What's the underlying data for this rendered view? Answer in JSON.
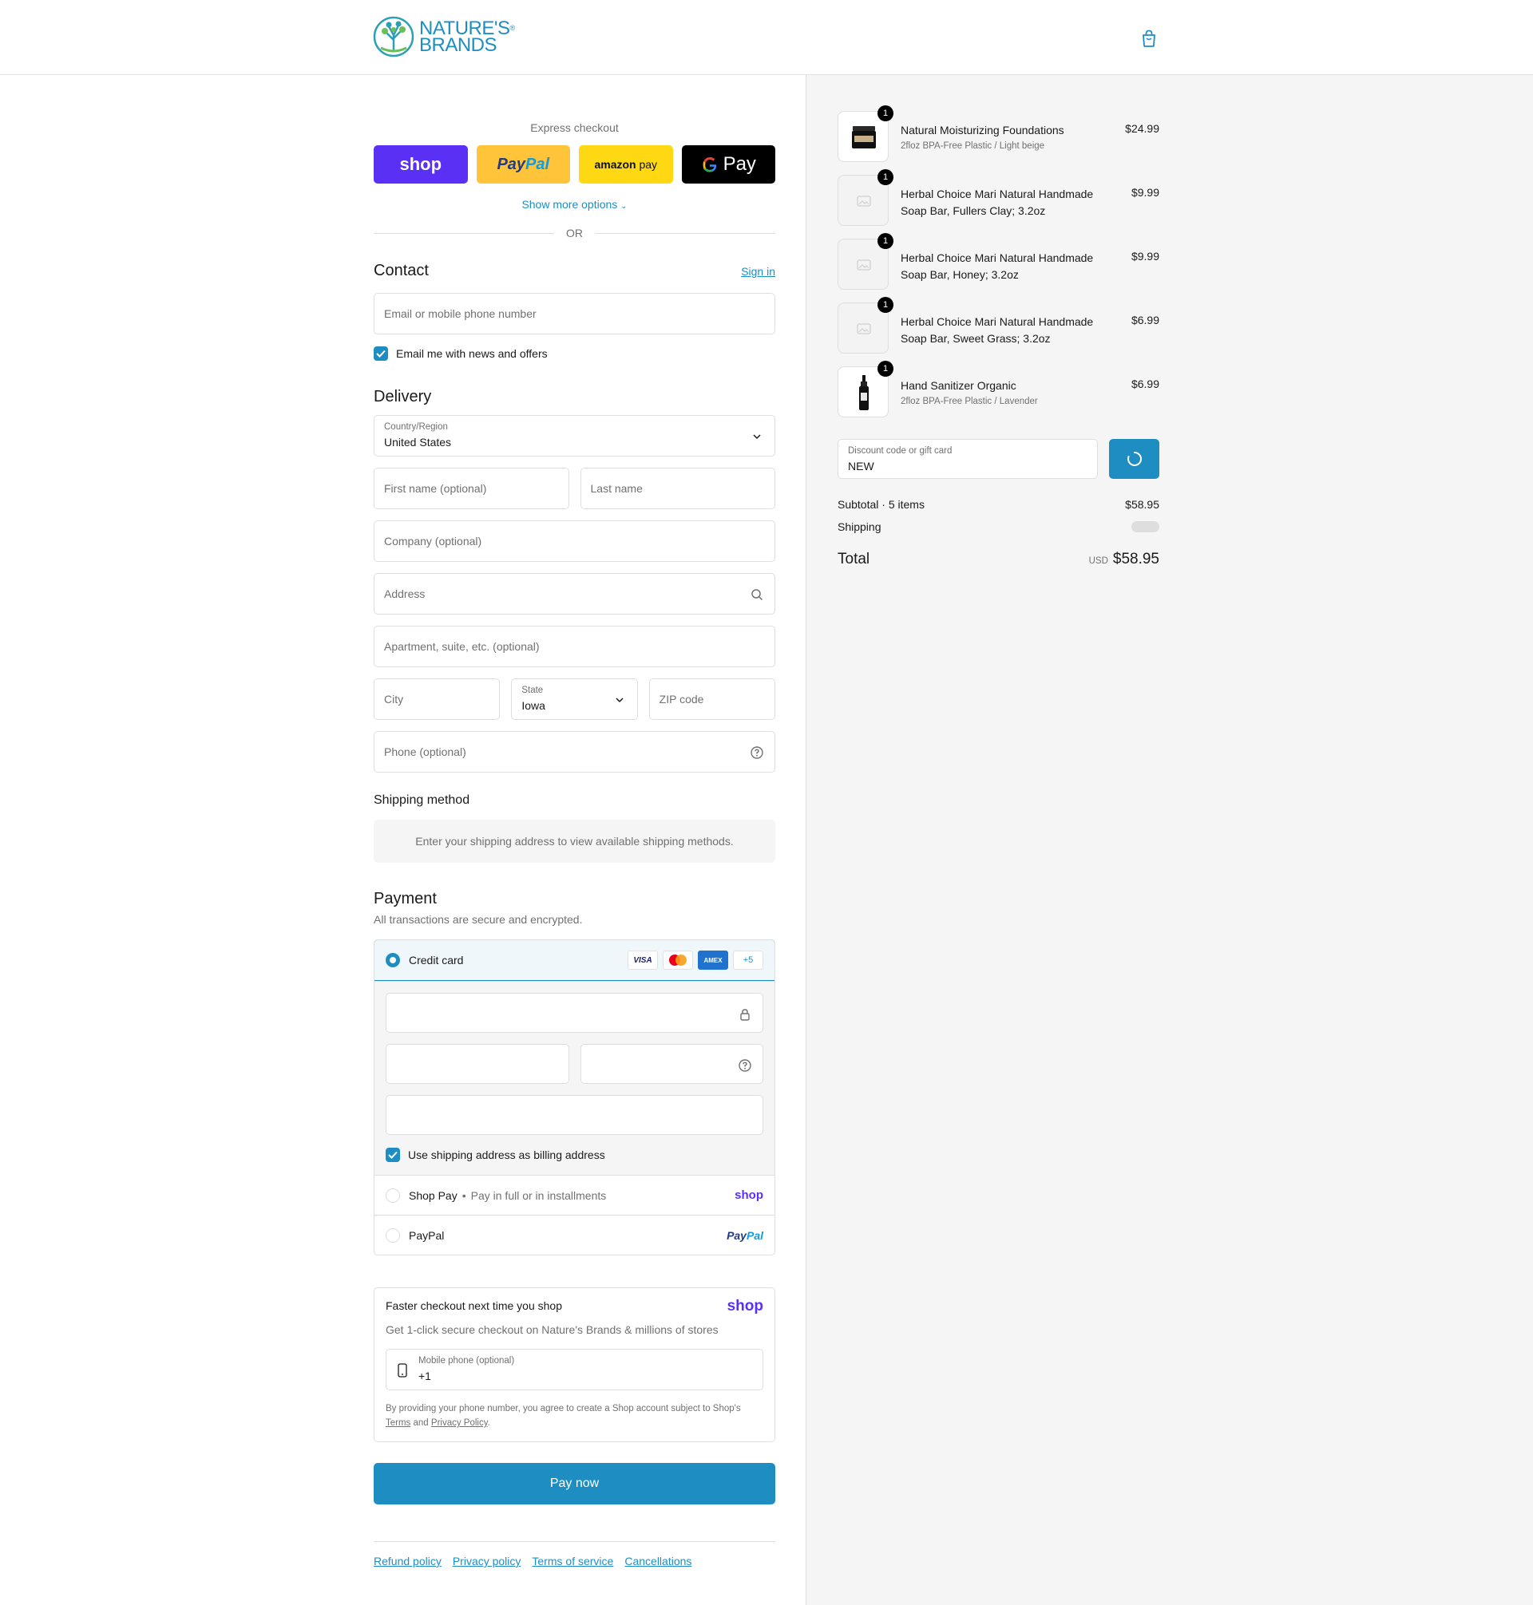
{
  "brand": {
    "line1": "NATURE'S",
    "line2": "BRANDS",
    "reg": "®",
    "color": "#1e8ec2"
  },
  "express": {
    "title": "Express checkout",
    "shop_label": "shop",
    "paypal_part1": "Pay",
    "paypal_part2": "Pal",
    "amazon_part1": "amazon",
    "amazon_part2": "pay",
    "gpay_label": "Pay",
    "more_options": "Show more options",
    "or": "OR"
  },
  "contact": {
    "title": "Contact",
    "sign_in": "Sign in",
    "email_placeholder": "Email or mobile phone number",
    "news_label": "Email me with news and offers"
  },
  "delivery": {
    "title": "Delivery",
    "country_label": "Country/Region",
    "country_value": "United States",
    "first_name": "First name (optional)",
    "last_name": "Last name",
    "company": "Company (optional)",
    "address": "Address",
    "apartment": "Apartment, suite, etc. (optional)",
    "city": "City",
    "state_label": "State",
    "state_value": "Iowa",
    "zip": "ZIP code",
    "phone": "Phone (optional)"
  },
  "shipping_method": {
    "title": "Shipping method",
    "message": "Enter your shipping address to view available shipping methods."
  },
  "payment": {
    "title": "Payment",
    "subtitle": "All transactions are secure and encrypted.",
    "credit_card": "Credit card",
    "card_logos": [
      "VISA",
      "",
      "AMEX",
      "+5"
    ],
    "billing_label": "Use shipping address as billing address",
    "shop_pay": "Shop Pay",
    "shop_pay_sub": "Pay in full or in installments",
    "shop_pay_logo": "shop",
    "paypal": "PayPal",
    "paypal_logo1": "Pay",
    "paypal_logo2": "Pal"
  },
  "faster": {
    "title": "Faster checkout next time you shop",
    "logo": "shop",
    "subtitle": "Get 1-click secure checkout on Nature's Brands & millions of stores",
    "phone_label": "Mobile phone (optional)",
    "phone_value": "+1",
    "legal_prefix": "By providing your phone number, you agree to create a Shop account subject to Shop's",
    "terms": "Terms",
    "and": "and",
    "privacy": "Privacy Policy",
    "period": "."
  },
  "pay_now": "Pay now",
  "footer": [
    "Refund policy",
    "Privacy policy",
    "Terms of service",
    "Cancellations"
  ],
  "cart": {
    "items": [
      {
        "qty": "1",
        "name": "Natural Moisturizing Foundations",
        "variant": "2floz BPA-Free Plastic / Light beige",
        "price": "$24.99"
      },
      {
        "qty": "1",
        "name": "Herbal Choice Mari Natural Handmade Soap Bar, Fullers Clay; 3.2oz",
        "variant": "",
        "price": "$9.99"
      },
      {
        "qty": "1",
        "name": "Herbal Choice Mari Natural Handmade Soap Bar, Honey; 3.2oz",
        "variant": "",
        "price": "$9.99"
      },
      {
        "qty": "1",
        "name": "Herbal Choice Mari Natural Handmade Soap Bar, Sweet Grass; 3.2oz",
        "variant": "",
        "price": "$6.99"
      },
      {
        "qty": "1",
        "name": "Hand Sanitizer Organic",
        "variant": "2floz BPA-Free Plastic / Lavender",
        "price": "$6.99"
      }
    ],
    "discount_label": "Discount code or gift card",
    "discount_value": "NEW",
    "subtotal_label": "Subtotal · 5 items",
    "subtotal_value": "$58.95",
    "shipping_label": "Shipping",
    "total_label": "Total",
    "currency": "USD",
    "total_value": "$58.95"
  }
}
